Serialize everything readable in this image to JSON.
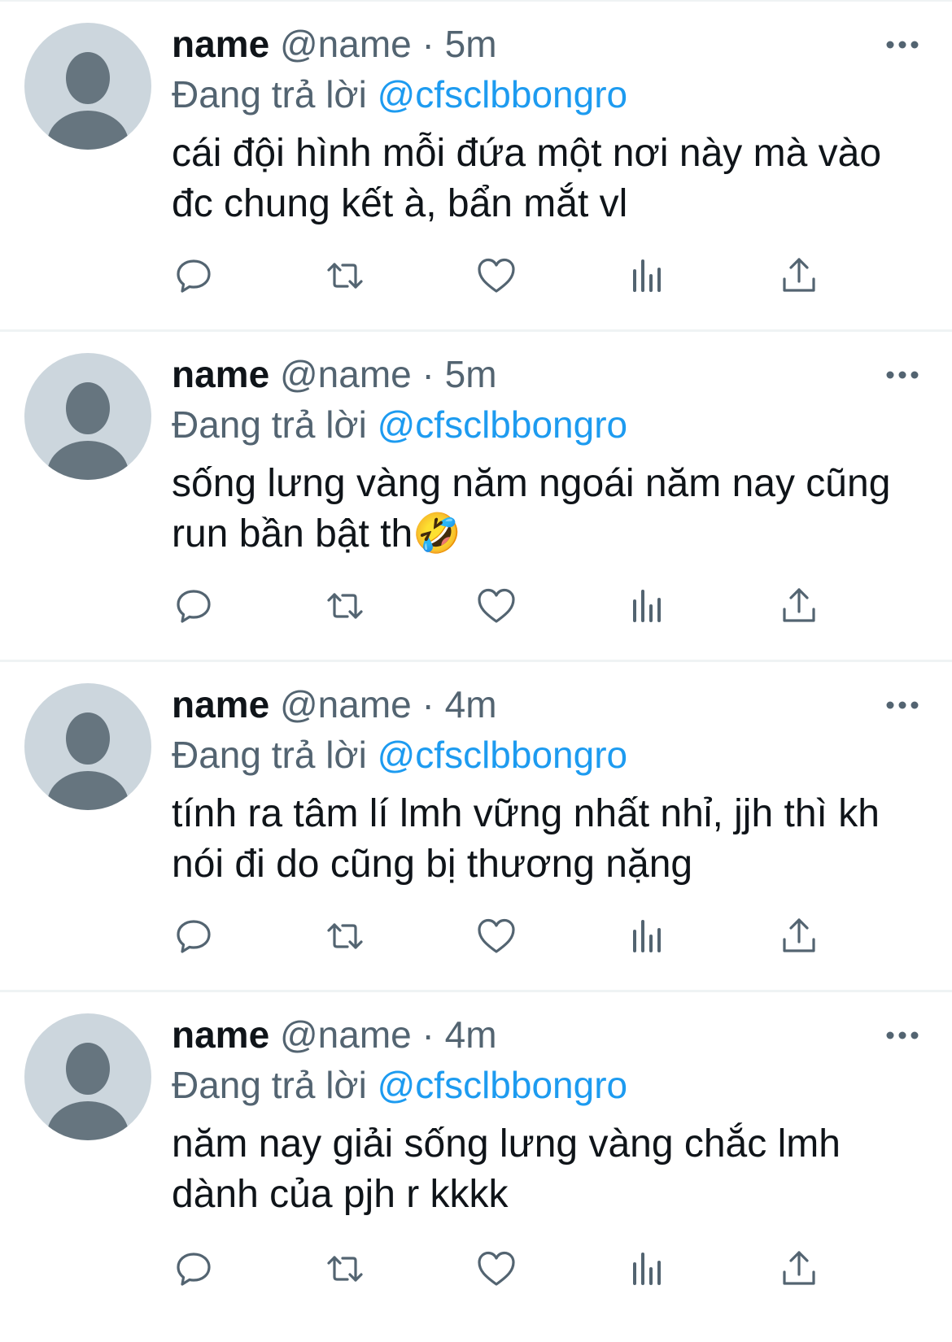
{
  "tweets": [
    {
      "display_name": "name",
      "handle": "@name",
      "separator": "·",
      "time": "5m",
      "replying_prefix": "Đang trả lời",
      "replying_to": "@cfsclbbongro",
      "text": "cái đội hình mỗi đứa một nơi này mà vào đc chung kết à, bẩn mắt vl"
    },
    {
      "display_name": "name",
      "handle": "@name",
      "separator": "·",
      "time": "5m",
      "replying_prefix": "Đang trả lời",
      "replying_to": "@cfsclbbongro",
      "text": "sống lưng vàng năm ngoái năm nay cũng run bần bật th🤣"
    },
    {
      "display_name": "name",
      "handle": "@name",
      "separator": "·",
      "time": "4m",
      "replying_prefix": "Đang trả lời",
      "replying_to": "@cfsclbbongro",
      "text": "tính ra tâm lí lmh vững nhất nhỉ, jjh thì kh nói đi do cũng bị thương nặng"
    },
    {
      "display_name": "name",
      "handle": "@name",
      "separator": "·",
      "time": "4m",
      "replying_prefix": "Đang trả lời",
      "replying_to": "@cfsclbbongro",
      "text": "năm nay giải sống lưng vàng chắc lmh dành của pjh r kkkk"
    }
  ],
  "icons": {
    "reply": "reply-icon",
    "retweet": "retweet-icon",
    "like": "heart-icon",
    "views": "views-icon",
    "share": "share-icon",
    "more": "more-icon",
    "avatar": "default-avatar-icon"
  },
  "colors": {
    "text_primary": "#0f1419",
    "text_secondary": "#536471",
    "link": "#1d9bf0",
    "avatar_bg": "#ccd6dd",
    "avatar_fg": "#66757f",
    "divider": "#eff3f4"
  }
}
